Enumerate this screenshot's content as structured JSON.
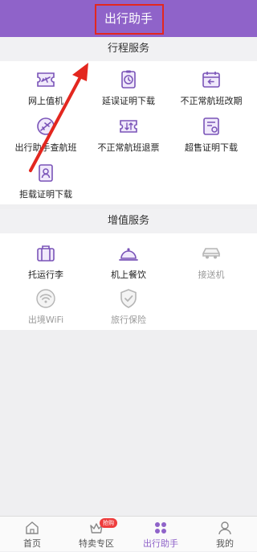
{
  "header": {
    "title": "出行助手"
  },
  "sections": {
    "trip": {
      "title": "行程服务",
      "items": [
        {
          "label": "网上值机",
          "icon": "boarding-pass-plane-icon"
        },
        {
          "label": "延误证明下载",
          "icon": "clock-certificate-icon"
        },
        {
          "label": "不正常航班改期",
          "icon": "calendar-change-icon"
        },
        {
          "label": "出行助手查航班",
          "icon": "flight-search-icon"
        },
        {
          "label": "不正常航班退票",
          "icon": "ticket-refund-icon"
        },
        {
          "label": "超售证明下载",
          "icon": "oversale-certificate-icon"
        },
        {
          "label": "拒载证明下载",
          "icon": "denied-boarding-badge-icon"
        }
      ]
    },
    "value_added": {
      "title": "增值服务",
      "items": [
        {
          "label": "托运行李",
          "icon": "suitcase-icon"
        },
        {
          "label": "机上餐饮",
          "icon": "meal-cloche-icon"
        },
        {
          "label": "接送机",
          "icon": "car-icon"
        },
        {
          "label": "出境WiFi",
          "icon": "wifi-icon"
        },
        {
          "label": "旅行保险",
          "icon": "shield-check-icon"
        }
      ]
    }
  },
  "tabbar": {
    "tabs": [
      {
        "label": "首页",
        "icon": "home-icon"
      },
      {
        "label": "特卖专区",
        "icon": "crown-icon",
        "badge": "抢购"
      },
      {
        "label": "出行助手",
        "icon": "grid-dots-icon",
        "active": true
      },
      {
        "label": "我的",
        "icon": "person-icon"
      }
    ]
  },
  "colors": {
    "accent": "#8f63c9",
    "highlight": "#e3271f",
    "badge": "#ee3d3d",
    "disabled": "#9a9a9a"
  }
}
